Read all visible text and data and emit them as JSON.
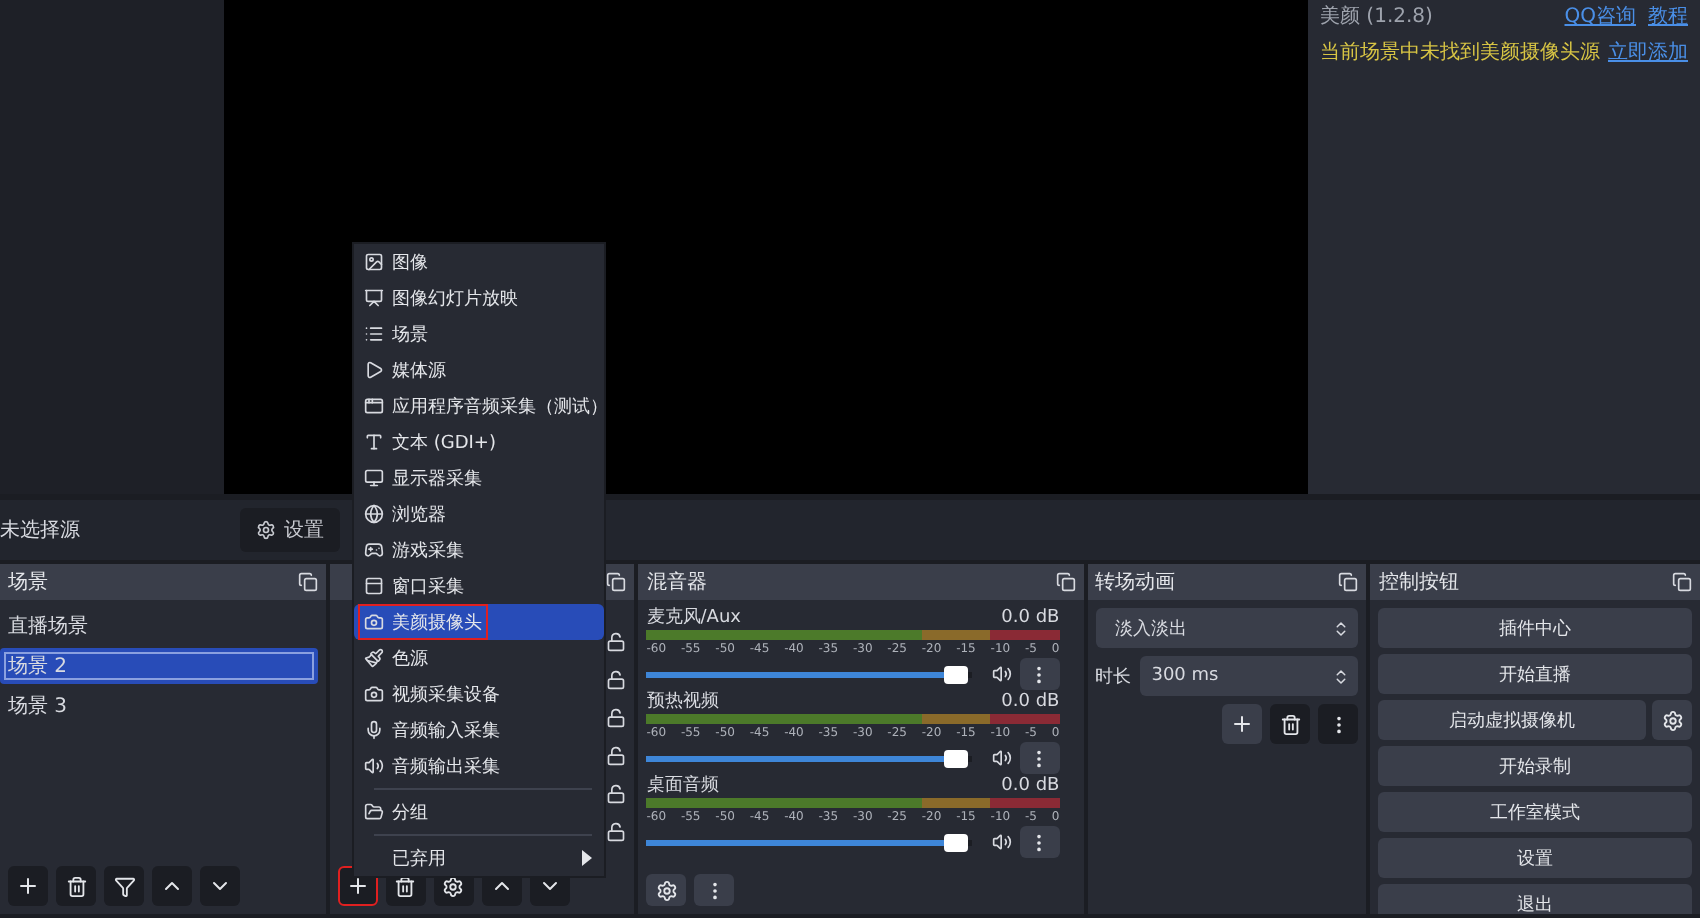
{
  "top_panel": {
    "plugin_title": "美颜 (1.2.8)",
    "links": [
      "QQ咨询",
      "教程"
    ],
    "warning": "当前场景中未找到美颜摄像头源",
    "action_link": "立即添加"
  },
  "source_bar": {
    "status": "未选择源",
    "button": "设置"
  },
  "scenes": {
    "title": "场景",
    "items": [
      {
        "label": "直播场景",
        "selected": false
      },
      {
        "label": "场景 2",
        "selected": true
      },
      {
        "label": "场景 3",
        "selected": false
      }
    ]
  },
  "sources": {
    "rows": [
      {
        "locked": false
      },
      {
        "locked": false
      },
      {
        "locked": false
      },
      {
        "locked": false
      },
      {
        "locked": false
      },
      {
        "locked": false
      }
    ],
    "add_button": {
      "annotated": true
    }
  },
  "add_menu": {
    "sections": [
      [
        {
          "label": "图像",
          "selected": false,
          "annotated": false
        },
        {
          "label": "图像幻灯片放映",
          "selected": false,
          "annotated": false
        },
        {
          "label": "场景",
          "selected": false,
          "annotated": false
        },
        {
          "label": "媒体源",
          "selected": false,
          "annotated": false
        },
        {
          "label": "应用程序音频采集（测试）",
          "selected": false,
          "annotated": false
        },
        {
          "label": "文本 (GDI+)",
          "selected": false,
          "annotated": false
        },
        {
          "label": "显示器采集",
          "selected": false,
          "annotated": false
        },
        {
          "label": "浏览器",
          "selected": false,
          "annotated": false
        },
        {
          "label": "游戏采集",
          "selected": false,
          "annotated": false
        },
        {
          "label": "窗口采集",
          "selected": false,
          "annotated": false
        },
        {
          "label": "美颜摄像头",
          "selected": true,
          "annotated": true
        },
        {
          "label": "色源",
          "selected": false,
          "annotated": false
        },
        {
          "label": "视频采集设备",
          "selected": false,
          "annotated": false
        },
        {
          "label": "音频输入采集",
          "selected": false,
          "annotated": false
        },
        {
          "label": "音频输出采集",
          "selected": false,
          "annotated": false
        }
      ],
      [
        {
          "label": "分组",
          "selected": false,
          "annotated": false
        }
      ],
      [
        {
          "label": "已弃用",
          "selected": false,
          "annotated": false,
          "submenu": true
        }
      ]
    ]
  },
  "mixer": {
    "title": "混音器",
    "channels": [
      {
        "name": "麦克风/Aux",
        "reading": "0.0 dB",
        "level": 0.95,
        "scale": [
          "-60",
          "-55",
          "-50",
          "-45",
          "-40",
          "-35",
          "-30",
          "-25",
          "-20",
          "-15",
          "-10",
          "-5",
          "0"
        ]
      },
      {
        "name": "预热视频",
        "reading": "0.0 dB",
        "level": 0.95,
        "scale": [
          "-60",
          "-55",
          "-50",
          "-45",
          "-40",
          "-35",
          "-30",
          "-25",
          "-20",
          "-15",
          "-10",
          "-5",
          "0"
        ]
      },
      {
        "name": "桌面音频",
        "reading": "0.0 dB",
        "level": 0.95,
        "scale": [
          "-60",
          "-55",
          "-50",
          "-45",
          "-40",
          "-35",
          "-30",
          "-25",
          "-20",
          "-15",
          "-10",
          "-5",
          "0"
        ]
      }
    ]
  },
  "transitions": {
    "title": "转场动画",
    "transition": "淡入淡出",
    "duration_label": "时长",
    "duration": "300 ms"
  },
  "controls": {
    "title": "控制按钮",
    "buttons": [
      {
        "label": "插件中心",
        "kind": "plain"
      },
      {
        "label": "开始直播",
        "kind": "plain"
      },
      {
        "label": "启动虚拟摄像机",
        "kind": "with_settings"
      },
      {
        "label": "开始录制",
        "kind": "plain"
      },
      {
        "label": "工作室模式",
        "kind": "plain"
      },
      {
        "label": "设置",
        "kind": "plain"
      },
      {
        "label": "退出",
        "kind": "plain"
      }
    ]
  }
}
